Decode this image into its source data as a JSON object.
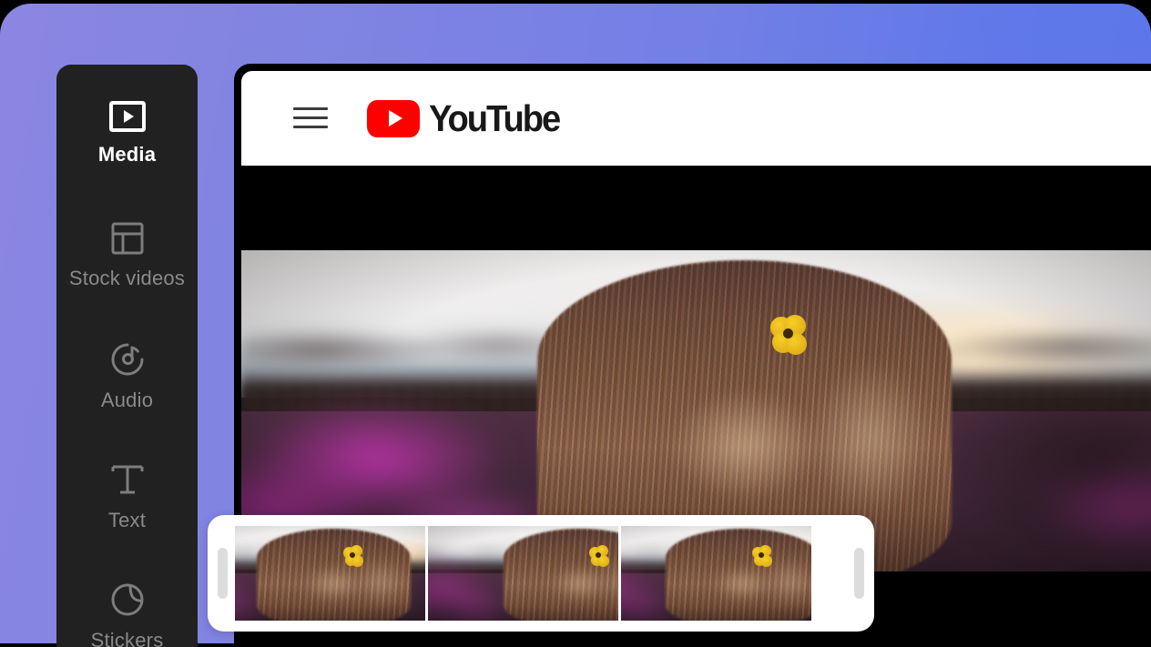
{
  "app": {
    "background_gradient_from": "#8b86e2",
    "background_gradient_to": "#5a75e9"
  },
  "sidebar": {
    "background": "#212121",
    "active_color": "#ffffff",
    "inactive_color": "#8a8a8a",
    "items": [
      {
        "label": "Media",
        "icon": "media-play-rect-icon",
        "active": true
      },
      {
        "label": "Stock videos",
        "icon": "layout-grid-icon",
        "active": false
      },
      {
        "label": "Audio",
        "icon": "music-note-circle-icon",
        "active": false
      },
      {
        "label": "Text",
        "icon": "text-t-icon",
        "active": false
      },
      {
        "label": "Stickers",
        "icon": "sticker-circle-icon",
        "active": false
      }
    ]
  },
  "browser": {
    "header_background": "#ffffff",
    "menu_icon": "hamburger-menu-icon",
    "logo": {
      "play_icon": "youtube-play-icon",
      "wordmark": "YouTube",
      "brand_color": "#FF0000",
      "wordmark_color": "#181818"
    }
  },
  "video": {
    "stage_background": "#000000",
    "alt": "Woman seen from behind with long blonde hair and a yellow flower tucked behind her ear, standing in a field of purple wildflowers at sunset"
  },
  "timeline": {
    "panel_background": "#ffffff",
    "handle_color": "#dcdcdc",
    "left_handle": "trim-start-handle",
    "right_handle": "trim-end-handle",
    "frames": [
      {
        "index": 1,
        "offset": "-46%"
      },
      {
        "index": 2,
        "offset": "-18%"
      },
      {
        "index": 3,
        "offset": "-34%"
      }
    ]
  }
}
